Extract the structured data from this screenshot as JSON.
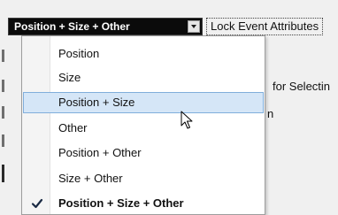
{
  "toolbar": {
    "dropdown_value": "Position + Size + Other",
    "lock_label": "Lock Event Attributes"
  },
  "background": {
    "text_selecting": "for Selectin",
    "text_n": "n"
  },
  "menu": {
    "items": [
      {
        "label": "Position",
        "state": "normal"
      },
      {
        "label": "Size",
        "state": "normal"
      },
      {
        "label": "Position + Size",
        "state": "hovered"
      },
      {
        "label": "Other",
        "state": "normal"
      },
      {
        "label": "Position + Other",
        "state": "normal"
      },
      {
        "label": "Size + Other",
        "state": "normal"
      },
      {
        "label": "Position + Size + Other",
        "state": "checked"
      }
    ]
  },
  "icons": {
    "dropdown_arrow": "chevron-down-icon",
    "check": "checkmark-icon",
    "cursor": "mouse-pointer-icon"
  },
  "colors": {
    "highlight_bg": "#d5e6f7",
    "highlight_border": "#80aedb",
    "dropdown_bg": "#0b0b0b"
  }
}
